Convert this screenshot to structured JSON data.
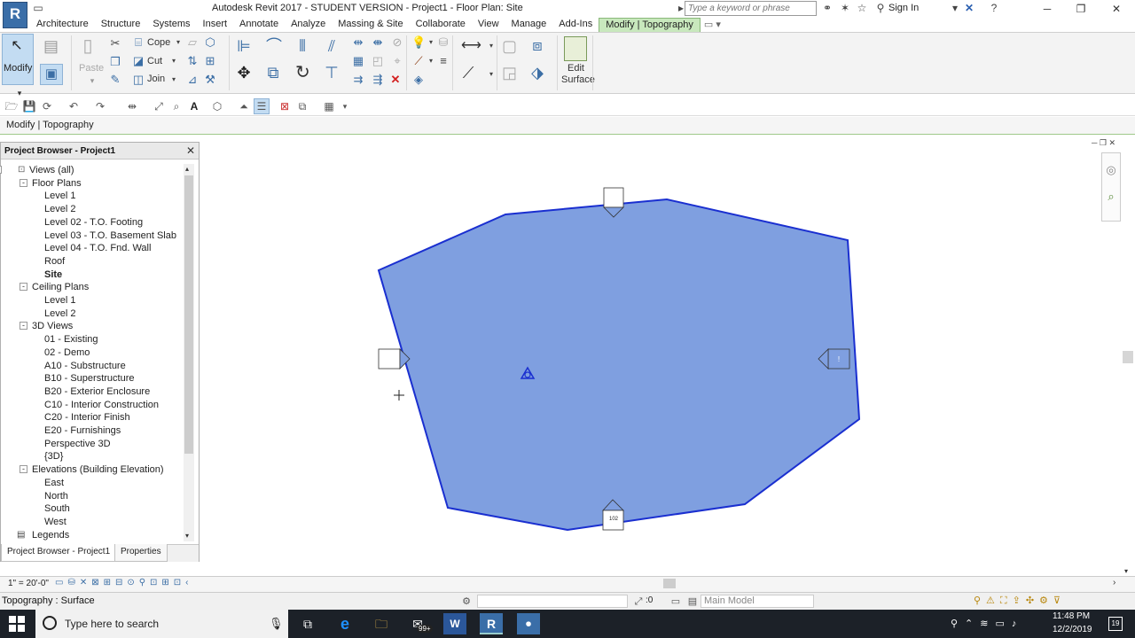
{
  "titlebar": {
    "logo": "R",
    "title": "Autodesk Revit 2017 - STUDENT VERSION -    Project1 - Floor Plan: Site",
    "search_placeholder": "Type a keyword or phrase",
    "signin": "Sign In"
  },
  "ribbon_tabs": [
    "Architecture",
    "Structure",
    "Systems",
    "Insert",
    "Annotate",
    "Analyze",
    "Massing & Site",
    "Collaborate",
    "View",
    "Manage",
    "Add-Ins",
    "Modify | Topography"
  ],
  "active_tab": "Modify | Topography",
  "ribbon": {
    "modify": "Modify",
    "paste": "Paste",
    "cope": "Cope",
    "cut": "Cut",
    "join": "Join",
    "edit_surface_line1": "Edit",
    "edit_surface_line2": "Surface"
  },
  "context_label": "Modify | Topography",
  "project_browser": {
    "title": "Project Browser - Project1",
    "close": "✕",
    "items": [
      {
        "label": "Views (all)",
        "level": 0,
        "toggle": "-"
      },
      {
        "label": "Floor Plans",
        "level": 1,
        "toggle": "-"
      },
      {
        "label": "Level 1",
        "level": 2
      },
      {
        "label": "Level 2",
        "level": 2
      },
      {
        "label": "Level 02 - T.O. Footing",
        "level": 2
      },
      {
        "label": "Level 03 - T.O. Basement Slab",
        "level": 2
      },
      {
        "label": "Level 04 - T.O. Fnd. Wall",
        "level": 2
      },
      {
        "label": "Roof",
        "level": 2
      },
      {
        "label": "Site",
        "level": 2,
        "bold": true
      },
      {
        "label": "Ceiling Plans",
        "level": 1,
        "toggle": "-"
      },
      {
        "label": "Level 1",
        "level": 2
      },
      {
        "label": "Level 2",
        "level": 2
      },
      {
        "label": "3D Views",
        "level": 1,
        "toggle": "-"
      },
      {
        "label": "01 - Existing",
        "level": 2
      },
      {
        "label": "02 - Demo",
        "level": 2
      },
      {
        "label": "A10 - Substructure",
        "level": 2
      },
      {
        "label": "B10 - Superstructure",
        "level": 2
      },
      {
        "label": "B20 - Exterior Enclosure",
        "level": 2
      },
      {
        "label": "C10 - Interior Construction",
        "level": 2
      },
      {
        "label": "C20 - Interior Finish",
        "level": 2
      },
      {
        "label": "E20 - Furnishings",
        "level": 2
      },
      {
        "label": "Perspective 3D",
        "level": 2
      },
      {
        "label": "{3D}",
        "level": 2
      },
      {
        "label": "Elevations (Building Elevation)",
        "level": 1,
        "toggle": "-"
      },
      {
        "label": "East",
        "level": 2
      },
      {
        "label": "North",
        "level": 2
      },
      {
        "label": "South",
        "level": 2
      },
      {
        "label": "West",
        "level": 2
      },
      {
        "label": "Legends",
        "level": 1,
        "icon": true
      }
    ],
    "tab_browser": "Project Browser - Project1",
    "tab_properties": "Properties"
  },
  "canvas": {
    "surface_color": "#7f9fe0",
    "outline_color": "#1a2fd0",
    "elevation_marker_bottom": "102"
  },
  "view_control": {
    "scale": "1\" = 20'-0\""
  },
  "status": {
    "text": "Topography : Surface",
    "coord": ":0",
    "workset": "Main Model"
  },
  "taskbar": {
    "search": "Type here to search",
    "time": "11:48 PM",
    "date": "12/2/2019",
    "mail_badge": "99+"
  }
}
